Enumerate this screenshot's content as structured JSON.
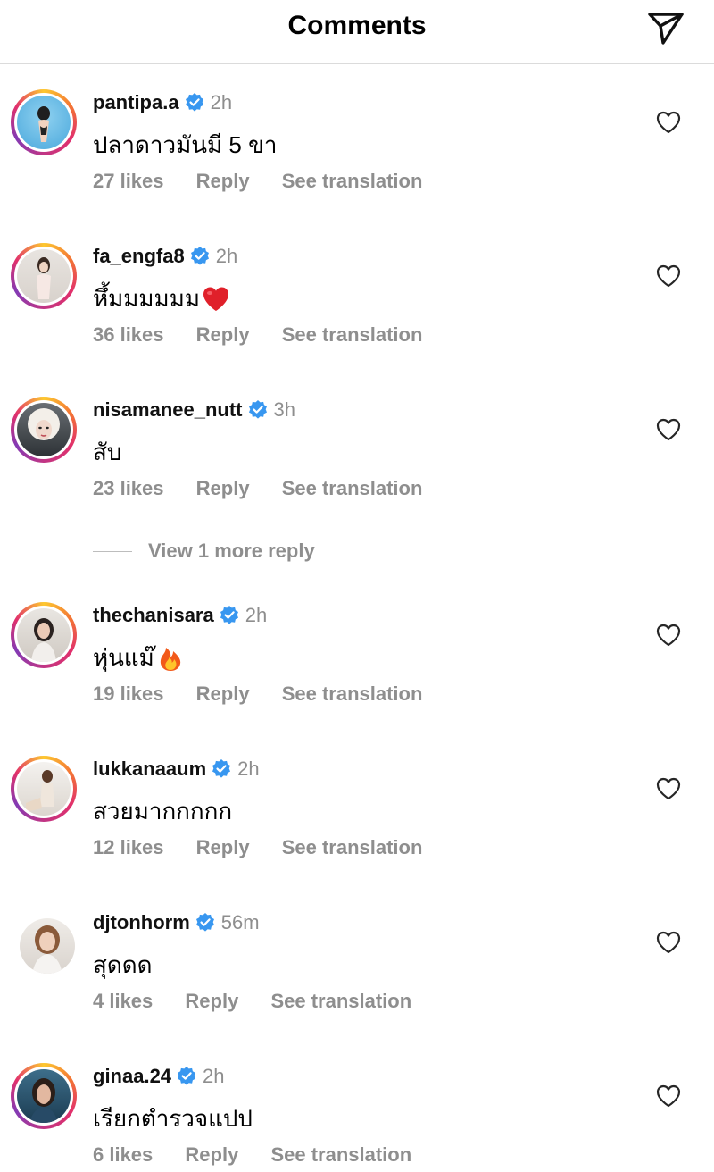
{
  "header": {
    "title": "Comments",
    "share_icon": "paper-plane-icon"
  },
  "comments": [
    {
      "username": "pantipa.a",
      "verified": true,
      "time": "2h",
      "text": "ปลาดาวมันมี 5 ขา",
      "emoji": "",
      "likes": "27 likes",
      "reply": "Reply",
      "translate": "See translation"
    },
    {
      "username": "fa_engfa8",
      "verified": true,
      "time": "2h",
      "text": "หึ้มมมมมม",
      "emoji": "red-heart-emoji",
      "likes": "36 likes",
      "reply": "Reply",
      "translate": "See translation"
    },
    {
      "username": "nisamanee_nutt",
      "verified": true,
      "time": "3h",
      "text": "สับ",
      "emoji": "",
      "likes": "23 likes",
      "reply": "Reply",
      "translate": "See translation"
    },
    {
      "username": "thechanisara",
      "verified": true,
      "time": "2h",
      "text": "หุ่นแม๊",
      "emoji": "fire-emoji",
      "likes": "19 likes",
      "reply": "Reply",
      "translate": "See translation"
    },
    {
      "username": "lukkanaaum",
      "verified": true,
      "time": "2h",
      "text": "สวยมากกกกก",
      "emoji": "",
      "likes": "12 likes",
      "reply": "Reply",
      "translate": "See translation"
    },
    {
      "username": "djtonhorm",
      "verified": true,
      "time": "56m",
      "text": "สุดดด",
      "emoji": "",
      "likes": "4 likes",
      "reply": "Reply",
      "translate": "See translation"
    },
    {
      "username": "ginaa.24",
      "verified": true,
      "time": "2h",
      "text": "เรียกตำรวจแปป",
      "emoji": "",
      "likes": "6 likes",
      "reply": "Reply",
      "translate": "See translation"
    }
  ],
  "view_more_replies": "View 1 more reply",
  "colors": {
    "verified": "#3897f0",
    "secondary_text": "#8e8e8e",
    "divider": "#dbdbdb"
  }
}
